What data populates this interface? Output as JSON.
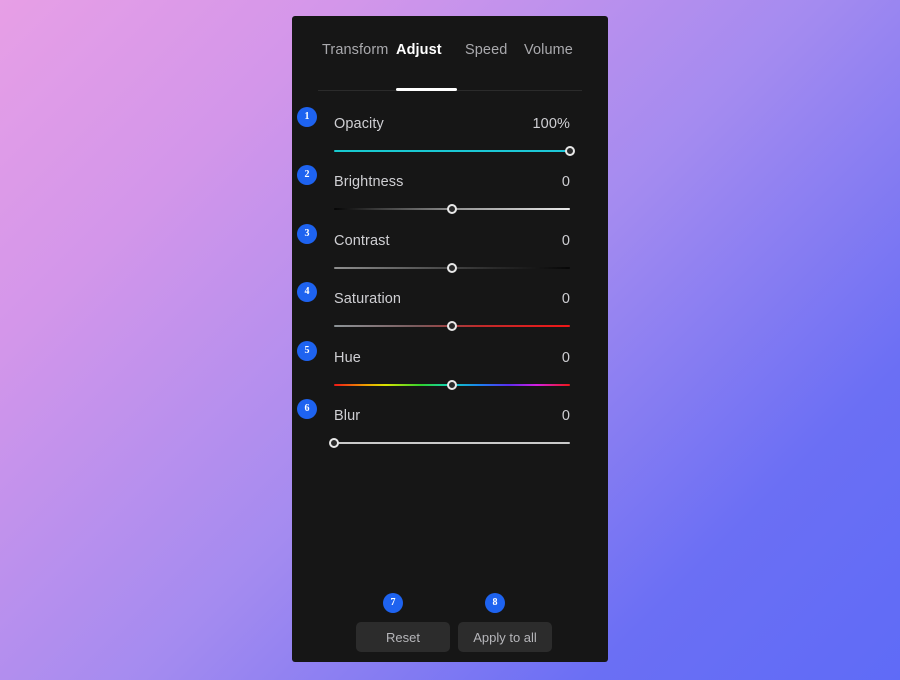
{
  "panel": {
    "tabs": [
      {
        "label": "Transform",
        "active": false
      },
      {
        "label": "Adjust",
        "active": true
      },
      {
        "label": "Speed",
        "active": false
      },
      {
        "label": "Volume",
        "active": false
      }
    ],
    "adjustments": [
      {
        "badge": "1",
        "label": "Opacity",
        "value": "100%",
        "percent": 100,
        "track": "opacity"
      },
      {
        "badge": "2",
        "label": "Brightness",
        "value": "0",
        "percent": 50,
        "track": "brightness"
      },
      {
        "badge": "3",
        "label": "Contrast",
        "value": "0",
        "percent": 50,
        "track": "contrast"
      },
      {
        "badge": "4",
        "label": "Saturation",
        "value": "0",
        "percent": 50,
        "track": "saturation"
      },
      {
        "badge": "5",
        "label": "Hue",
        "value": "0",
        "percent": 50,
        "track": "hue"
      },
      {
        "badge": "6",
        "label": "Blur",
        "value": "0",
        "percent": 0,
        "track": "blur"
      }
    ],
    "footer": {
      "reset_label": "Reset",
      "reset_badge": "7",
      "apply_label": "Apply to all",
      "apply_badge": "8"
    },
    "colors": {
      "panel_background": "#161616",
      "badge": "#1e63f0",
      "active_tab": "#ffffff",
      "inactive_tab": "#a9a9ad",
      "label": "#cfcfd3",
      "opacity_track": "#18c9cf",
      "button_background": "#2c2c2c",
      "backdrop_start": "#e79fe6",
      "backdrop_end": "#5f6bf7"
    }
  }
}
